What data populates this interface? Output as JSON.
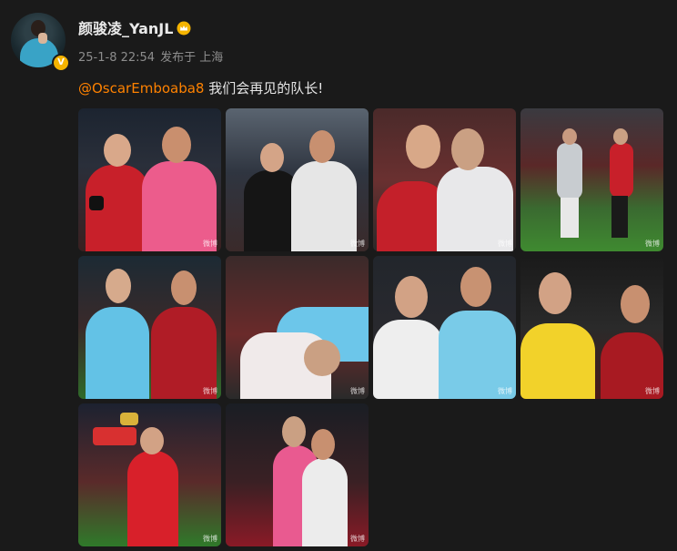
{
  "user": {
    "name": "颜骏凌_YanJL",
    "avatar": "avatar",
    "verified_icon": "v-badge-icon",
    "vip_icon": "crown-icon",
    "vip_color": "#f5b400"
  },
  "post": {
    "date": "25-1-8 22:54",
    "source": "发布于 上海",
    "mention": "@OscarEmboaba8",
    "text": " 我们会再见的队长!",
    "mention_color": "#ff8200"
  },
  "images": [
    {
      "alt": "photo-1"
    },
    {
      "alt": "photo-2"
    },
    {
      "alt": "photo-3"
    },
    {
      "alt": "photo-4"
    },
    {
      "alt": "photo-5"
    },
    {
      "alt": "photo-6"
    },
    {
      "alt": "photo-7"
    },
    {
      "alt": "photo-8"
    },
    {
      "alt": "photo-9"
    },
    {
      "alt": "photo-10"
    }
  ],
  "watermark": "微博"
}
